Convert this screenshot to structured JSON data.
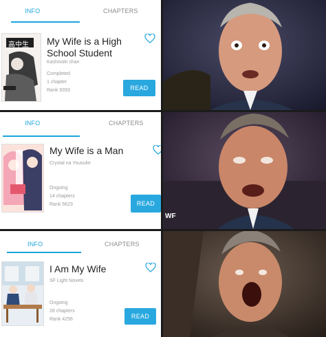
{
  "panels": [
    {
      "tabs": {
        "info": "INFO",
        "chapters": "CHAPTERS"
      },
      "title_line1": "My Wife is a High",
      "title_line2": "School Student",
      "author": "Kashinoki chan",
      "status": "Completed",
      "chapters": "1 chapter",
      "rank": "Rank 9393",
      "read": "READ"
    },
    {
      "tabs": {
        "info": "INFO",
        "chapters": "CHAPTERS"
      },
      "title_line1": "My Wife is a Man",
      "author": "Crystal na Yousuke",
      "status": "Ongoing",
      "chapters": "14 chapters",
      "rank": "Rank 5623",
      "read": "READ"
    },
    {
      "tabs": {
        "info": "INFO",
        "chapters": "CHAPTERS"
      },
      "title_line1": "I Am My Wife",
      "author": "SF Light Novels",
      "status": "Ongoing",
      "chapters": "28 chapters",
      "rank": "Rank 4256",
      "read": "READ"
    }
  ],
  "cover_text": {
    "c1": "高中生"
  },
  "watermark": "WF",
  "colors": {
    "accent": "#29a8df",
    "tab_active": "#1aa5dc"
  },
  "icons": {
    "favorite": "heart-outline-icon"
  }
}
